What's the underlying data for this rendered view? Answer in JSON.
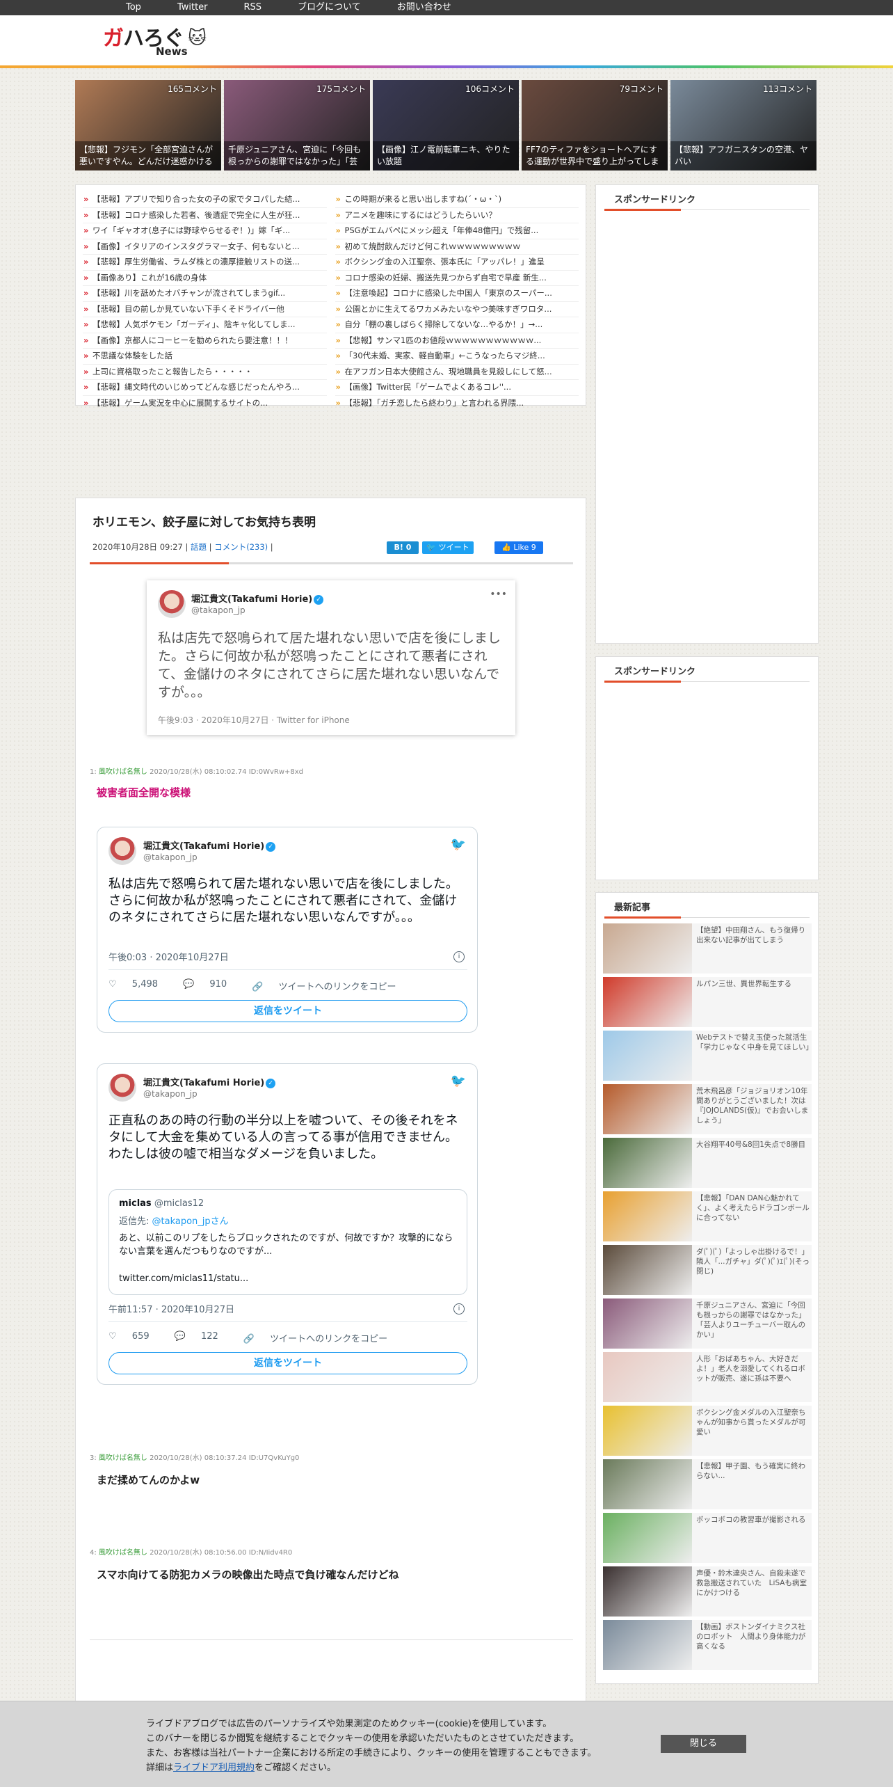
{
  "nav": [
    "Top",
    "Twitter",
    "RSS",
    "ブログについて",
    "お問い合わせ"
  ],
  "logo": {
    "main": "ガハろぐ",
    "sub": "News",
    "mascot": "cat-icon"
  },
  "thumbs": [
    {
      "count": "165コメント",
      "caption": "【悲報】フジモン「全部宮迫さんが悪いですやん。どんだけ迷惑かける",
      "color": "#b07a55"
    },
    {
      "count": "175コメント",
      "caption": "千原ジュニアさん、宮迫に「今回も根っからの謝罪ではなかった」「芸",
      "color": "#8a5a7a"
    },
    {
      "count": "106コメント",
      "caption": "【画像】江ノ電前転車ニキ、やりたい放題",
      "color": "#3a3a55"
    },
    {
      "count": "79コメント",
      "caption": "FF7のティファをショートヘアにする運動が世界中で盛り上がってしま",
      "color": "#6a4a3e"
    },
    {
      "count": "113コメント",
      "caption": "【悲報】アフガニスタンの空港、ヤバい",
      "color": "#7a8a9a"
    }
  ],
  "links_left": [
    "【悲報】アプリで知り合った女の子の家でタコパした結...",
    "【悲報】コロナ感染した若者、後遺症で完全に人生が狂...",
    "ワイ「ギャオオ(息子には野球やらせるぞ！)」嫁「ギ...",
    "【画像】イタリアのインスタグラマー女子、何もないと...",
    "【悲報】厚生労働省、ラムダ株との濃厚接触リストの送...",
    "【画像あり】これが16歳の身体",
    "【悲報】川を舐めたオバチャンが流されてしまうgif...",
    "【悲報】目の前しか見ていない下手くそドライバー他",
    "【悲報】人気ポケモン「ガーディ」、陰キャ化してしま...",
    "【画像】京都人にコーヒーを勧められたら要注意！！！",
    "不思議な体験をした話",
    "上司に資格取ったこと報告したら・・・・・",
    "【悲報】縄文時代のいじめってどんな感じだったんやろ...",
    "【悲報】ゲーム実況を中心に展開するサイトの..."
  ],
  "links_right": [
    "この時期が来ると思い出しますね(´・ω・`)",
    "アニメを趣味にするにはどうしたらいい？",
    "PSGがエムバペにメッシ超え「年俸48億円」で残留...",
    "初めて焼酎飲んだけど何これｗｗｗｗｗｗｗｗｗ",
    "ボクシング金の入江聖奈、張本氏に「アッパレ！」進呈",
    "コロナ感染の妊婦、搬送先見つからず自宅で早産 新生...",
    "【注意喚起】コロナに感染した中国人「東京のスーパー...",
    "公園とかに生えてるワカメみたいなやつ美味すぎワロタ...",
    "自分「棚の裏しばらく掃除してないな…やるか！」→...",
    "【悲報】サンマ1匹のお値段ｗｗｗｗｗｗｗｗｗｗｗ...",
    "「30代未婚、実家、軽自動車」←こうなったらマジ終...",
    "在アフガン日本大使館さん、現地職員を見殺しにして怒...",
    "【画像】Twitter民「ゲームでよくあるコレ''...",
    "【悲報】「ガチ恋したら終わり」と言われる界隈..."
  ],
  "sidebar": {
    "sponsor1": "スポンサードリンク",
    "sponsor2": "スポンサードリンク",
    "recent_title": "最新記事"
  },
  "article": {
    "title": "ホリエモン、餃子屋に対してお気持ち表明",
    "date": "2020年10月28日 09:27",
    "category": "話題",
    "comments": "コメント(233)",
    "hatena": "B! 0",
    "tweet": "ツイート",
    "like": "Like 9"
  },
  "tweet_embed": {
    "name": "堀江貴文(Takafumi Horie)",
    "handle": "@takapon_jp",
    "text": "私は店先で怒鳴られて居た堪れない思いで店を後にしました。さらに何故か私が怒鳴ったことにされて悪者にされて、金儲けのネタにされてさらに居た堪れない思いなんですが。。。",
    "footer": "午後9:03 · 2020年10月27日 · Twitter for iPhone"
  },
  "res1": {
    "meta_num": "1: ",
    "meta_name": "風吹けば名無し",
    "meta_rest": " 2020/10/28(水) 08:10:02.74 ID:0WvRw+8xd",
    "body": "被害者面全開な模様"
  },
  "card1": {
    "name": "堀江貴文(Takafumi Horie)",
    "handle": "@takapon_jp",
    "text": "私は店先で怒鳴られて居た堪れない思いで店を後にしました。さらに何故か私が怒鳴ったことにされて悪者にされて、金儲けのネタにされてさらに居た堪れない思いなんですが。。。",
    "time": "午後0:03 · 2020年10月27日",
    "likes": "5,498",
    "replies": "910",
    "copy": "ツイートへのリンクをコピー",
    "reply": "返信をツイート"
  },
  "card2": {
    "name": "堀江貴文(Takafumi Horie)",
    "handle": "@takapon_jp",
    "text": "正直私のあの時の行動の半分以上を嘘ついて、その後それをネタにして大金を集めている人の言ってる事が信用できません。わたしは彼の嘘で相当なダメージを負いました。",
    "q_name": "miclas",
    "q_handle": "@miclas12",
    "q_reply_pre": "返信先: ",
    "q_reply_to": "@takapon_jpさん",
    "q_text": "あと、以前このリプをしたらブロックされたのですが、何故ですか？攻撃的にならない言葉を選んだつもりなのですが...",
    "q_link": "twitter.com/miclas11/statu...",
    "time": "午前11:57 · 2020年10月27日",
    "likes": "659",
    "replies": "122",
    "copy": "ツイートへのリンクをコピー",
    "reply": "返信をツイート"
  },
  "res3": {
    "meta_num": "3: ",
    "meta_name": "風吹けば名無し",
    "meta_rest": " 2020/10/28(水) 08:10:37.24 ID:U7QvKuYg0",
    "body": "まだ揉めてんのかよw"
  },
  "res4": {
    "meta_num": "4: ",
    "meta_name": "風吹けば名無し",
    "meta_rest": " 2020/10/28(水) 08:10:56.00 ID:N/Iidv4R0",
    "body": "スマホ向けてる防犯カメラの映像出た時点で負け確なんだけどね"
  },
  "recent": [
    {
      "t": "【絶望】中田翔さん、もう復帰り出来ない記事が出てしまう",
      "c": "#c8a890"
    },
    {
      "t": "ルパン三世、異世界転生する",
      "c": "#d03a2a"
    },
    {
      "t": "Webテストで替え玉使った就活生「学力じゃなく中身を見てほしい」",
      "c": "#9ec9e8"
    },
    {
      "t": "荒木飛呂彦「ジョジョリオン10年間ありがとうございました！次は『JOJOLANDS(仮)』でお会いしましょう」",
      "c": "#b55a2a"
    },
    {
      "t": "大谷翔平40号&8回1失点で8勝目",
      "c": "#4a6a3a"
    },
    {
      "t": "【悲報】「DAN DAN心魅かれてく」、よく考えたらドラゴンボールに合ってない",
      "c": "#e8a030"
    },
    {
      "t": "ダ(ﾟ)(ﾟ)「よっしゃ出掛けるで！」隣人「...ガチャ」ダ(ﾟ)(ﾟ)ｴ(ﾟ)(そっ閉じ)",
      "c": "#5a4a3a"
    },
    {
      "t": "千原ジュニアさん、宮迫に「今回も根っからの謝罪ではなかった」「芸人よりユーチューバー取んのかい」",
      "c": "#8a5a7a"
    },
    {
      "t": "人形「おばあちゃん、大好きだよ！」老人を溺愛してくれるロボットが販売、遂に孫は不要へ",
      "c": "#e8c8c0"
    },
    {
      "t": "ボクシング金メダルの入江聖奈ちゃんが知事から貰ったメダルが可愛い",
      "c": "#e8c030"
    },
    {
      "t": "【悲報】甲子園、もう確実に終わらない...",
      "c": "#6a7a5a"
    },
    {
      "t": "ボッコボコの教習車が撮影される",
      "c": "#6ab060"
    },
    {
      "t": "声優・鈴木達央さん、自殺未遂で救急搬送されていた　LiSAも病室にかけつける",
      "c": "#3a3030"
    },
    {
      "t": "【動画】ボストンダイナミクス社のロボット　人間より身体能力が高くなる",
      "c": "#7a8a9a"
    }
  ],
  "cookie": {
    "line1": "ライブドアブログでは広告のパーソナライズや効果測定のためクッキー(cookie)を使用しています。",
    "line2": "このバナーを閉じるか閲覧を継続することでクッキーの使用を承認いただいたものとさせていただきます。",
    "line3": "また、お客様は当社パートナー企業における所定の手続きにより、クッキーの使用を管理することもできます。",
    "line4_pre": "詳細は",
    "line4_link": "ライブドア利用規約",
    "line4_post": "をご確認ください。",
    "close": "閉じる"
  }
}
